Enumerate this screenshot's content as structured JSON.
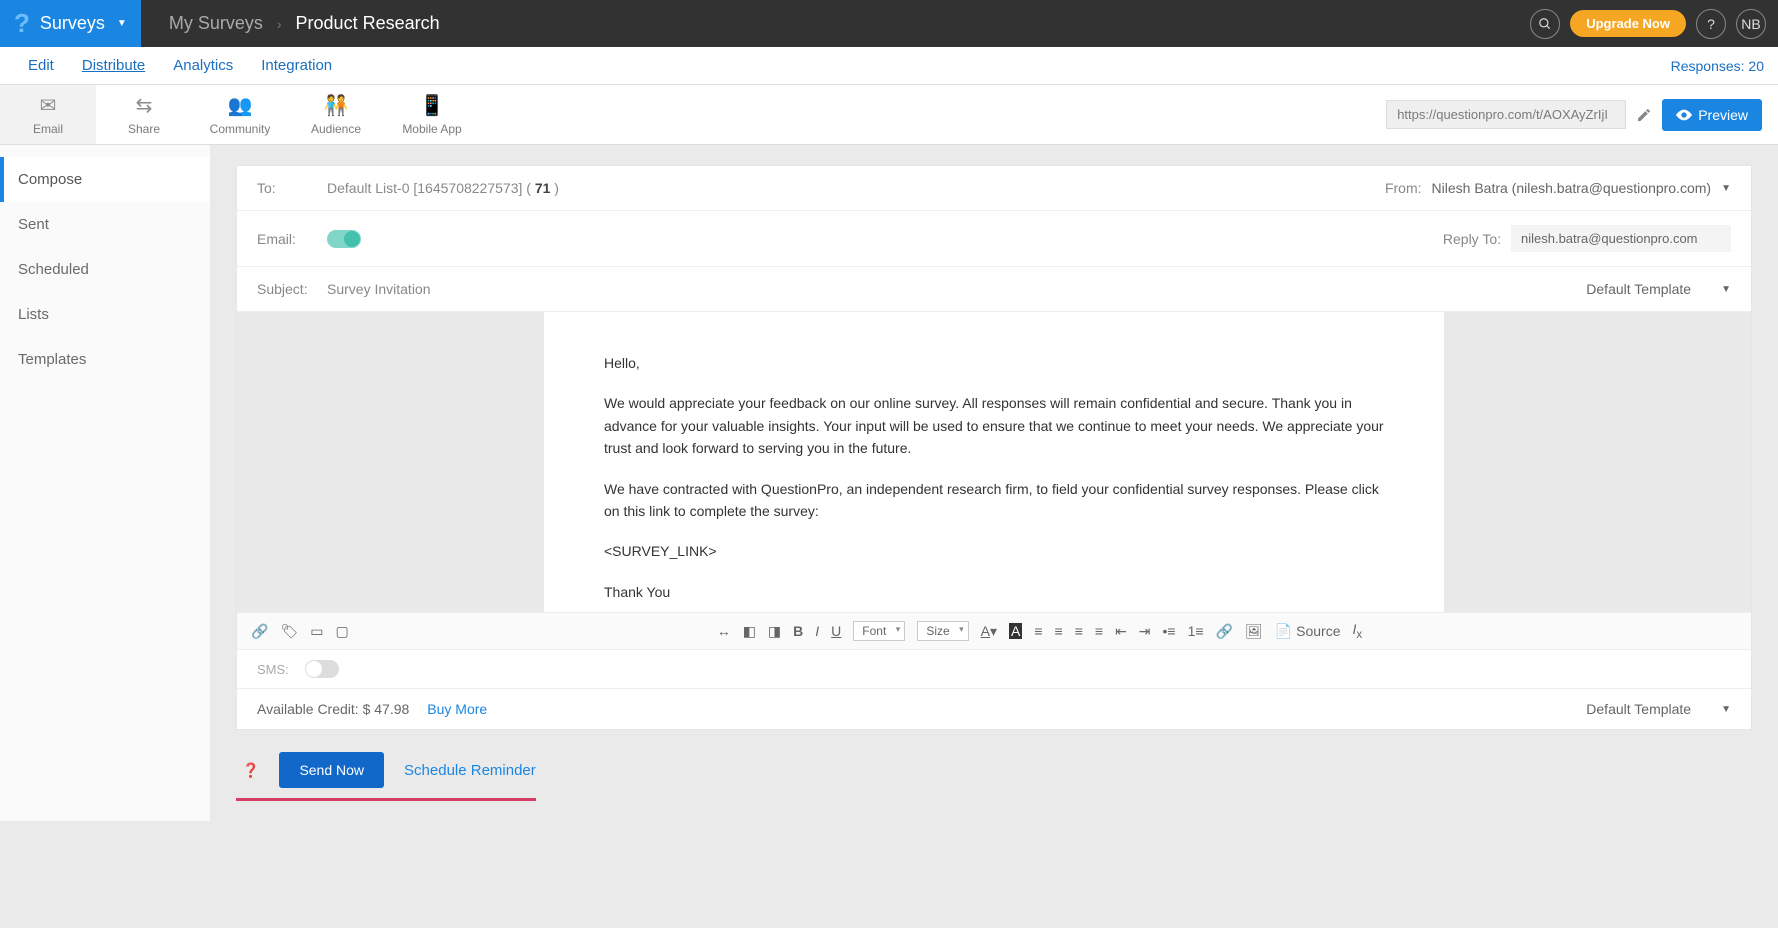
{
  "topbar": {
    "brand_label": "Surveys",
    "breadcrumb_root": "My Surveys",
    "breadcrumb_current": "Product Research",
    "upgrade_label": "Upgrade Now",
    "help_label": "?",
    "avatar_initials": "NB"
  },
  "tabs": {
    "items": [
      "Edit",
      "Distribute",
      "Analytics",
      "Integration"
    ],
    "responses_label": "Responses: 20"
  },
  "dist_toolbar": {
    "items": [
      {
        "label": "Email"
      },
      {
        "label": "Share"
      },
      {
        "label": "Community"
      },
      {
        "label": "Audience"
      },
      {
        "label": "Mobile App"
      }
    ],
    "survey_url": "https://questionpro.com/t/AOXAyZrIjI",
    "preview_label": "Preview"
  },
  "sidebar": {
    "items": [
      "Compose",
      "Sent",
      "Scheduled",
      "Lists",
      "Templates"
    ]
  },
  "compose": {
    "to_label": "To:",
    "to_value_prefix": "Default List-0 [1645708227573] ( ",
    "to_count": "71",
    "to_value_suffix": " )",
    "from_label": "From:",
    "from_value": "Nilesh Batra (nilesh.batra@questionpro.com)",
    "email_label": "Email:",
    "reply_to_label": "Reply To:",
    "reply_to_value": "nilesh.batra@questionpro.com",
    "subject_label": "Subject:",
    "subject_value": "Survey Invitation",
    "template_label": "Default Template"
  },
  "email_body": {
    "p1": "Hello,",
    "p2": "We would appreciate your feedback on our online survey. All responses will remain confidential and secure. Thank you in advance for your valuable insights. Your input will be used to ensure that we continue to meet your needs. We appreciate your trust and look forward to serving you in the future.",
    "p3": "We have contracted with QuestionPro, an independent research firm, to field your confidential survey responses. Please click on this link to complete the survey:",
    "p4": "<SURVEY_LINK>",
    "p5": "Thank You"
  },
  "editor": {
    "font_label": "Font",
    "size_label": "Size",
    "source_label": "Source"
  },
  "sms": {
    "label": "SMS:"
  },
  "credit": {
    "label": "Available Credit: $ 47.98",
    "buy_more": "Buy More",
    "template_label": "Default Template"
  },
  "actions": {
    "send_now": "Send Now",
    "schedule": "Schedule Reminder"
  }
}
